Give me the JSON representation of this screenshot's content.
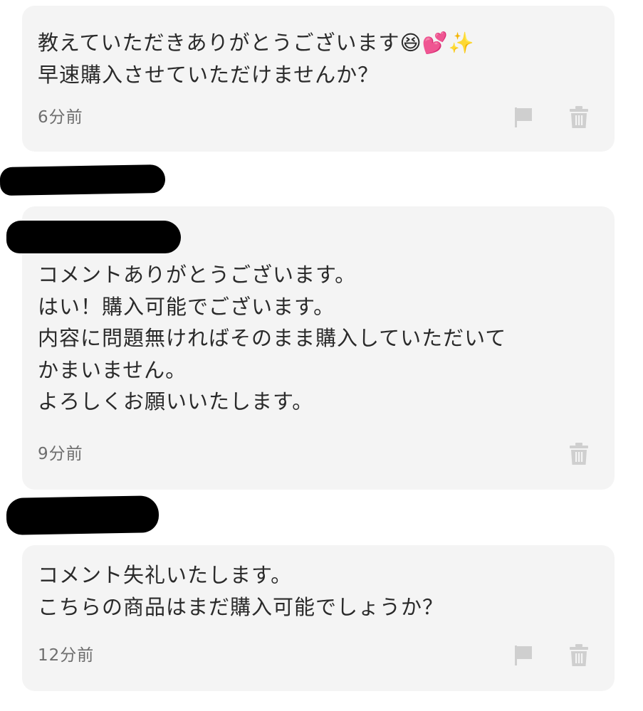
{
  "comments": [
    {
      "text": "教えていただきありがとうございます😆💕✨\n早速購入させていただけませんか？",
      "time": "6分前",
      "actions": [
        "flag-icon",
        "trash-icon"
      ]
    },
    {
      "text": "コメントありがとうございます。\nはい！購入可能でございます。\n内容に問題無ければそのまま購入していただいて\nかまいません。\nよろしくお願いいたします。",
      "time": "9分前",
      "actions": [
        "trash-icon"
      ]
    },
    {
      "text": "コメント失礼いたします。\nこちらの商品はまだ購入可能でしょうか？",
      "time": "12分前",
      "actions": [
        "flag-icon",
        "trash-icon"
      ]
    }
  ],
  "colors": {
    "bubble_bg": "#f4f4f4",
    "text": "#2a2a2a",
    "timestamp": "#6e6e6e",
    "icon": "#cfcfcf",
    "redaction": "#000000"
  }
}
